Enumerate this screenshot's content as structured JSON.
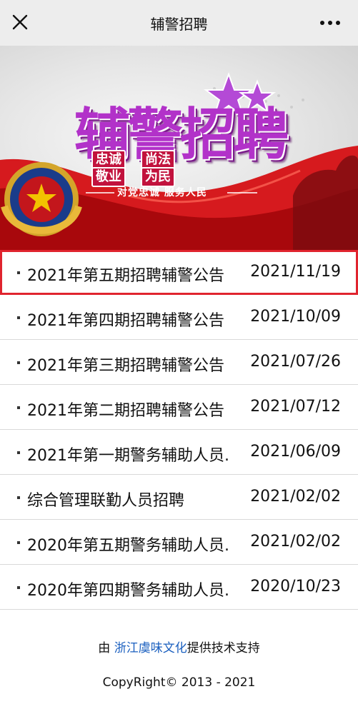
{
  "header": {
    "title": "辅警招聘",
    "close_icon": "close-icon",
    "more_icon": "more-icon"
  },
  "banner": {
    "title": "辅警招聘",
    "box1": "忠诚",
    "box2": "尚法",
    "box3": "敬业",
    "box4": "为民",
    "slogan": "对党忠诚 服务人民",
    "colors": {
      "title": "#b232c9",
      "accent": "#c2123d"
    }
  },
  "list": {
    "items": [
      {
        "name": "2021年第五期招聘辅警公告",
        "date": "2021/11/19"
      },
      {
        "name": "2021年第四期招聘辅警公告",
        "date": "2021/10/09"
      },
      {
        "name": "2021年第三期招聘辅警公告",
        "date": "2021/07/26"
      },
      {
        "name": "2021年第二期招聘辅警公告",
        "date": "2021/07/12"
      },
      {
        "name": "2021年第一期警务辅助人员.",
        "date": "2021/06/09"
      },
      {
        "name": "综合管理联勤人员招聘",
        "date": "2021/02/02"
      },
      {
        "name": "2020年第五期警务辅助人员.",
        "date": "2021/02/02"
      },
      {
        "name": "2020年第四期警务辅助人员.",
        "date": "2020/10/23"
      }
    ],
    "selected_index": 0,
    "highlight_color": "#e0242e"
  },
  "footer": {
    "tech_prefix": "由 ",
    "tech_link": "浙江虞味文化",
    "tech_suffix": "提供技术支持",
    "copyright": "CopyRight© 2013 - 2021",
    "link_color": "#1a5fbf"
  }
}
